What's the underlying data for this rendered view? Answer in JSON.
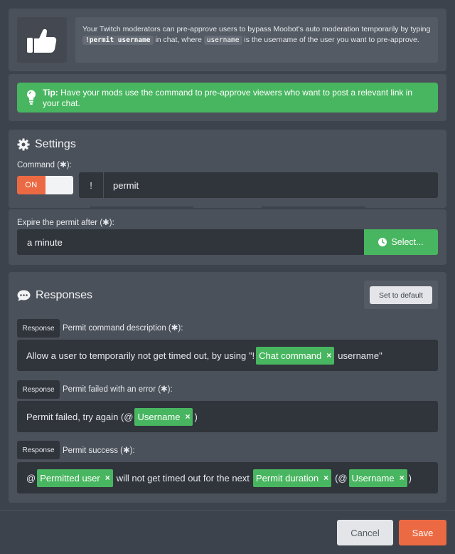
{
  "intro": {
    "text_before": "Your Twitch moderators can pre-approve users to bypass Moobot's auto moderation temporarily by typing",
    "code_command": "!permit username",
    "text_middle": "in chat, where",
    "code_username": "username",
    "text_after": "is the username of the user you want to pre-approve."
  },
  "tip": {
    "label": "Tip:",
    "text": "Have your mods use the command to pre-approve viewers who want to post a relevant link in your chat."
  },
  "settings": {
    "title": "Settings",
    "command_label": "Command (✱):",
    "toggle_label": "ON",
    "command_prefix": "!",
    "command_value": "permit",
    "expire_label": "Expire the permit after (✱):",
    "expire_value": "a minute",
    "select_label": "Select..."
  },
  "responses": {
    "title": "Responses",
    "default_button": "Set to default",
    "items": [
      {
        "tag": "Response",
        "label": "Permit command description (✱):",
        "text_1": "Allow a user to temporarily not get timed out, by using \"!",
        "chip_1": "Chat command",
        "text_2": "username\""
      },
      {
        "tag": "Response",
        "label": "Permit failed with an error (✱):",
        "text_1": "Permit failed, try again (@",
        "chip_1": "Username",
        "text_2": ")"
      },
      {
        "tag": "Response",
        "label": "Permit success (✱):",
        "text_1": "@",
        "chip_1": "Permitted user",
        "text_2": "will not get timed out for the next",
        "chip_2": "Permit duration",
        "text_3": "(@",
        "chip_3": "Username",
        "text_4": ")"
      }
    ]
  },
  "chip_remove_glyph": "×",
  "footer": {
    "cancel": "Cancel",
    "save": "Save"
  },
  "colors": {
    "accent_green": "#48b660",
    "accent_orange": "#ec6a43",
    "background": "#3d434c",
    "panel": "#4b515a",
    "input": "#30343b"
  }
}
